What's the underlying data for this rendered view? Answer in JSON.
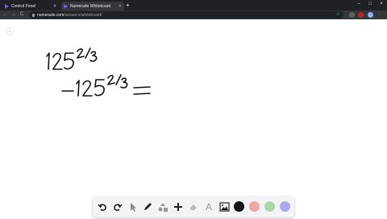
{
  "browser": {
    "tabs": [
      {
        "label": "Control Panel",
        "active": false
      },
      {
        "label": "Numerade Whiteboard",
        "active": true
      }
    ],
    "new_tab_symbol": "+",
    "window_controls": [
      "–",
      "□",
      "×"
    ],
    "nav": {
      "back": "←",
      "forward": "→",
      "reload": "C"
    },
    "url": {
      "host": "numerade.com",
      "path": "/answers/whiteboard/"
    },
    "icons": [
      "star-icon",
      "extension-icon",
      "profile-icon",
      "menu-icon"
    ]
  },
  "whiteboard": {
    "page_indicator": "1",
    "handwriting": {
      "line1_base": "125",
      "line1_exponent": "2/3",
      "line2_sign": "−",
      "line2_base": "125",
      "line2_exponent": "2/3",
      "line2_equals": "="
    }
  },
  "palette": {
    "tools": [
      "undo-icon",
      "redo-icon",
      "select-icon",
      "pen-icon",
      "shapes-icon",
      "add-icon",
      "eraser-icon",
      "text-icon",
      "image-icon"
    ],
    "text_tool_label": "A",
    "colors": [
      "#111111",
      "#f2a5a5",
      "#a6d9a3",
      "#a9a9f0"
    ]
  }
}
